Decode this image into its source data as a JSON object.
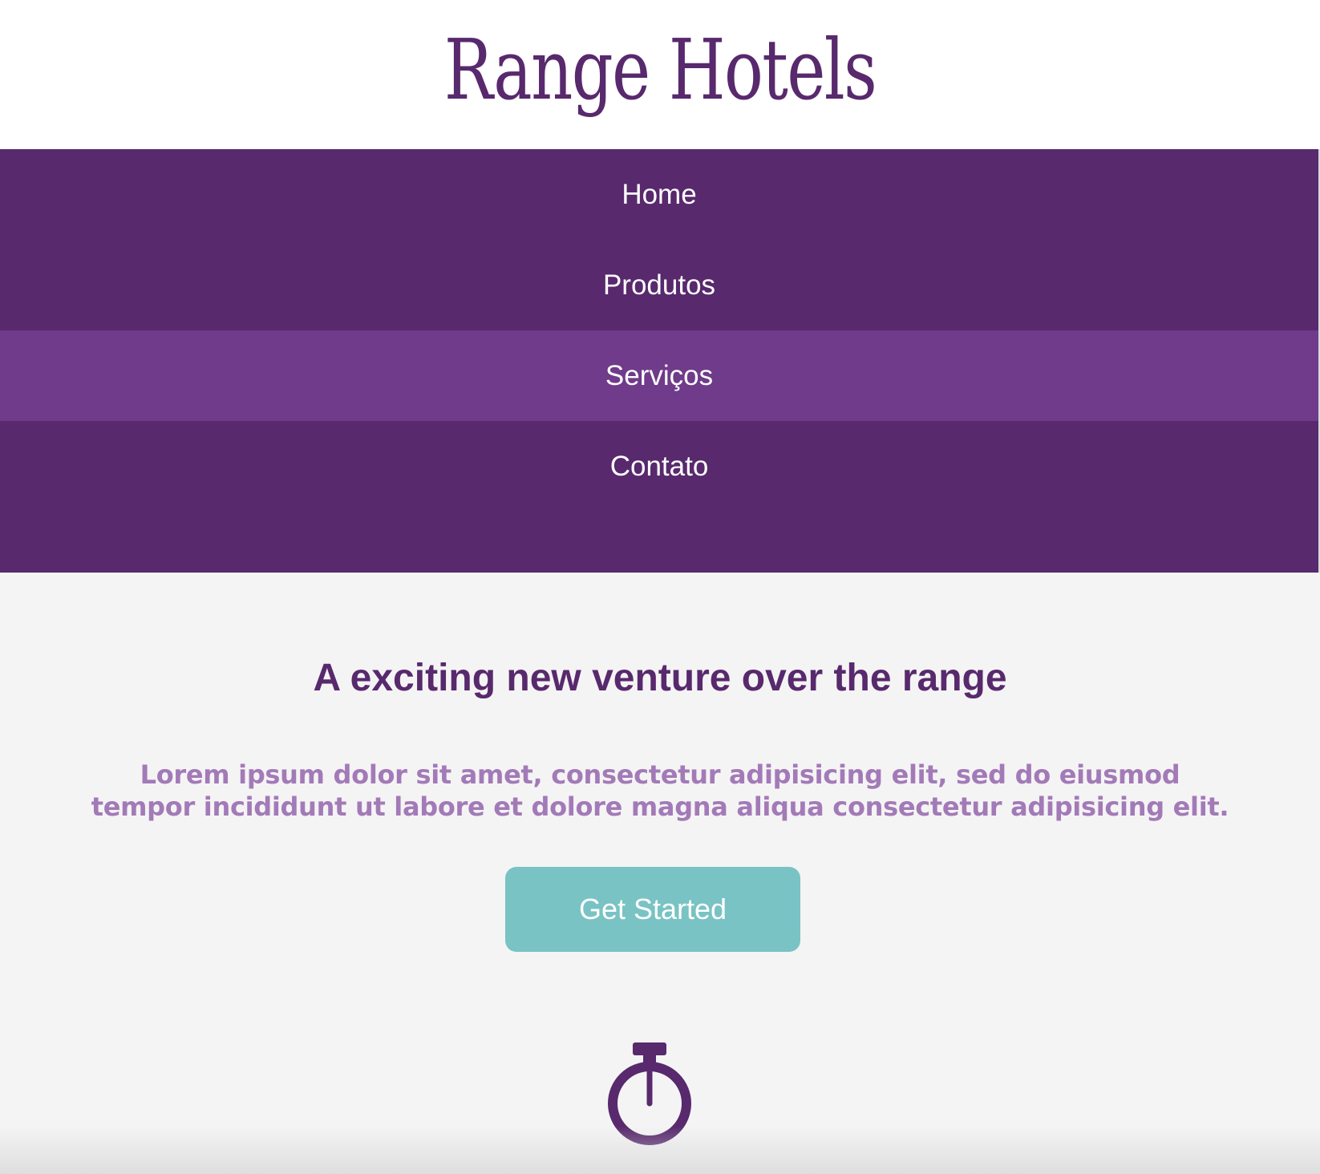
{
  "header": {
    "brand": "Range Hotels"
  },
  "nav": {
    "items": [
      {
        "label": "Home"
      },
      {
        "label": "Produtos"
      },
      {
        "label": "Serviços"
      },
      {
        "label": "Contato"
      }
    ],
    "active_index": 2
  },
  "hero": {
    "title": "A exciting new venture over the range",
    "description": "Lorem ipsum dolor sit amet, consectetur adipisicing elit, sed do eiusmod tempor incididunt ut labore et dolore magna aliqua consectetur adipisicing elit.",
    "cta_label": "Get Started",
    "icon": "stopwatch-icon"
  },
  "colors": {
    "brand": "#58296d",
    "nav_active": "#6f3b8a",
    "description": "#a37ab8",
    "cta": "#79c3c4",
    "hero_bg": "#f4f4f4"
  }
}
